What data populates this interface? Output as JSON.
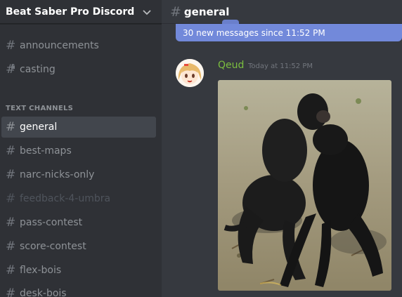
{
  "server": {
    "name": "Beat Saber Pro Discord"
  },
  "channels_top": [
    {
      "name": "announcements",
      "locked": false
    },
    {
      "name": "casting",
      "locked": true
    }
  ],
  "category": {
    "label": "TEXT CHANNELS"
  },
  "channels": [
    {
      "name": "general",
      "state": "active"
    },
    {
      "name": "best-maps",
      "state": "normal"
    },
    {
      "name": "narc-nicks-only",
      "state": "normal"
    },
    {
      "name": "feedback-4-umbra",
      "state": "muted"
    },
    {
      "name": "pass-contest",
      "state": "normal"
    },
    {
      "name": "score-contest",
      "state": "normal"
    },
    {
      "name": "flex-bois",
      "state": "normal"
    },
    {
      "name": "desk-bois",
      "state": "normal"
    }
  ],
  "channel_header": {
    "title": "general"
  },
  "new_messages": {
    "text": "30 new messages since 11:52 PM"
  },
  "message": {
    "author": "Qeud",
    "timestamp": "Today at 11:52 PM"
  },
  "colors": {
    "accent": "#7289da",
    "author": "#7bbf3f",
    "sidebar": "#2f3136",
    "chat_bg": "#36393f"
  }
}
